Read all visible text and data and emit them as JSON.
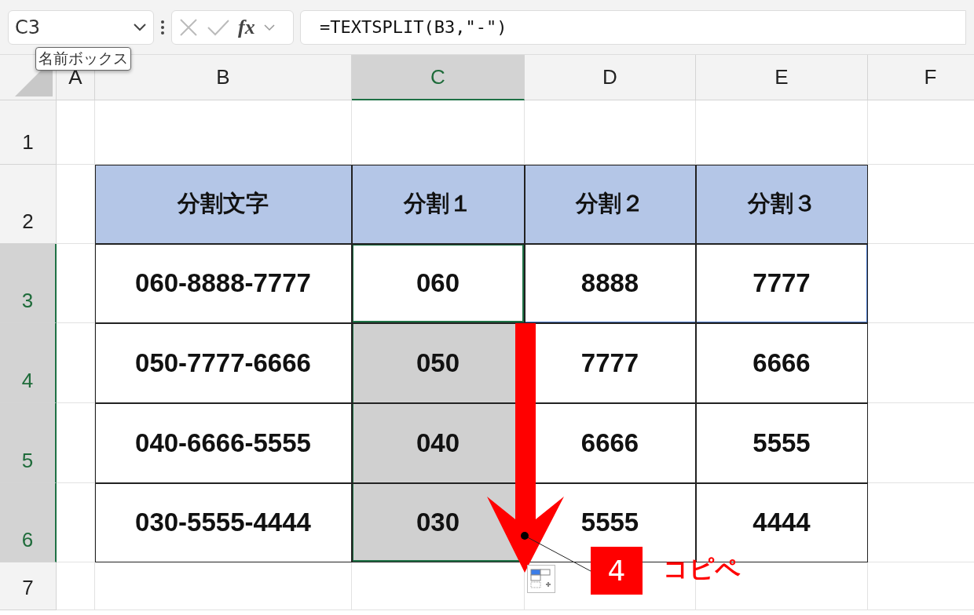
{
  "name_box": {
    "value": "C3",
    "tooltip": "名前ボックス"
  },
  "formula_bar": {
    "fx": "fx",
    "value": "=TEXTSPLIT(B3,\"-\")"
  },
  "column_headers": [
    {
      "label": "A",
      "selected": false
    },
    {
      "label": "B",
      "selected": false
    },
    {
      "label": "C",
      "selected": true
    },
    {
      "label": "D",
      "selected": false
    },
    {
      "label": "E",
      "selected": false
    },
    {
      "label": "F",
      "selected": false
    }
  ],
  "rows": [
    {
      "label": "1",
      "selected": false,
      "spill": false,
      "cells": []
    },
    {
      "label": "2",
      "selected": false,
      "spill": false,
      "cells": [
        {
          "text": "分割文字",
          "kind": "header",
          "selected": false,
          "active": false
        },
        {
          "text": "分割１",
          "kind": "header",
          "selected": false,
          "active": false
        },
        {
          "text": "分割２",
          "kind": "header",
          "selected": false,
          "active": false
        },
        {
          "text": "分割３",
          "kind": "header",
          "selected": false,
          "active": false
        }
      ]
    },
    {
      "label": "3",
      "selected": true,
      "spill": true,
      "cells": [
        {
          "text": "060-8888-7777",
          "kind": "data",
          "selected": false,
          "active": false
        },
        {
          "text": "060",
          "kind": "data",
          "selected": true,
          "active": true
        },
        {
          "text": "8888",
          "kind": "data",
          "selected": false,
          "active": false
        },
        {
          "text": "7777",
          "kind": "data",
          "selected": false,
          "active": false
        }
      ]
    },
    {
      "label": "4",
      "selected": true,
      "spill": false,
      "cells": [
        {
          "text": "050-7777-6666",
          "kind": "data",
          "selected": false,
          "active": false
        },
        {
          "text": "050",
          "kind": "data",
          "selected": true,
          "active": false
        },
        {
          "text": "7777",
          "kind": "data",
          "selected": false,
          "active": false
        },
        {
          "text": "6666",
          "kind": "data",
          "selected": false,
          "active": false
        }
      ]
    },
    {
      "label": "5",
      "selected": true,
      "spill": false,
      "cells": [
        {
          "text": "040-6666-5555",
          "kind": "data",
          "selected": false,
          "active": false
        },
        {
          "text": "040",
          "kind": "data",
          "selected": true,
          "active": false
        },
        {
          "text": "6666",
          "kind": "data",
          "selected": false,
          "active": false
        },
        {
          "text": "5555",
          "kind": "data",
          "selected": false,
          "active": false
        }
      ]
    },
    {
      "label": "6",
      "selected": true,
      "spill": false,
      "cells": [
        {
          "text": "030-5555-4444",
          "kind": "data",
          "selected": false,
          "active": false
        },
        {
          "text": "030",
          "kind": "data",
          "selected": true,
          "active": false
        },
        {
          "text": "5555",
          "kind": "data",
          "selected": false,
          "active": false
        },
        {
          "text": "4444",
          "kind": "data",
          "selected": false,
          "active": false
        }
      ]
    },
    {
      "label": "7",
      "selected": false,
      "spill": false,
      "cells": []
    }
  ],
  "callout": {
    "number": "4",
    "label": "コピペ"
  }
}
